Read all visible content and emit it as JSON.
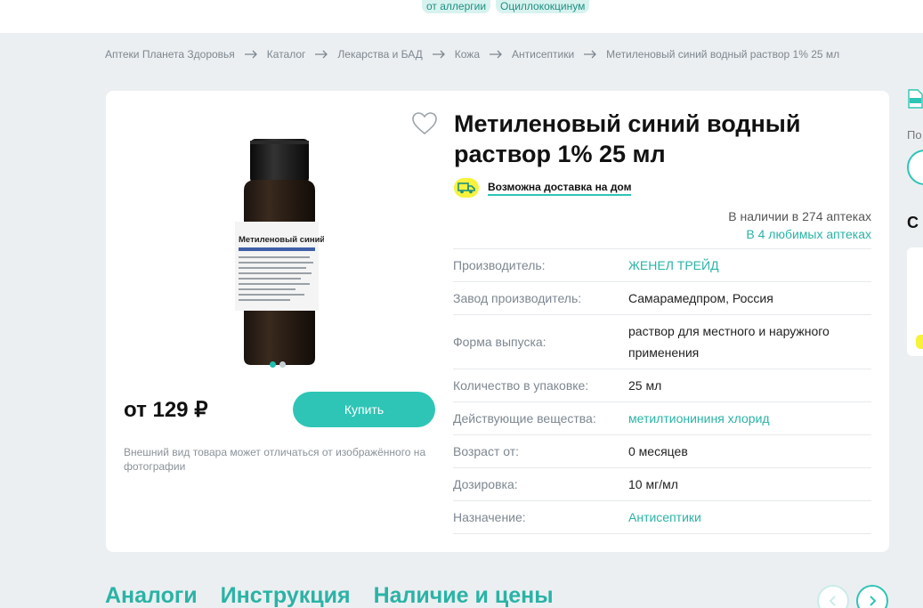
{
  "top_tags": [
    "от аллергии",
    "Оциллококцинум"
  ],
  "breadcrumb": [
    "Аптеки Планета Здоровья",
    "Каталог",
    "Лекарства и БАД",
    "Кожа",
    "Антисептики",
    "Метиленовый синий водный раствор 1% 25 мл"
  ],
  "product": {
    "title": "Метиленовый синий водный раствор 1% 25 мл",
    "delivery_label": "Возможна доставка на дом",
    "availability_count": "В наличии в 274 аптеках",
    "availability_fav": "В 4 любимых аптеках",
    "price": "от 129 ₽",
    "buy_label": "Купить",
    "disclaimer": "Внешний вид товара может отличаться от изображённого на фотографии",
    "bottle_label": "Метиленовый синий",
    "images_total": 2,
    "active_image": 1
  },
  "properties": [
    {
      "label": "Производитель:",
      "value": "ЖЕНЕЛ ТРЕЙД",
      "link": true
    },
    {
      "label": "Завод производитель:",
      "value": "Самарамедпром, Россия",
      "link": false
    },
    {
      "label": "Форма выпуска:",
      "value": "раствор для местного и наружного применения",
      "link": false
    },
    {
      "label": "Количество в упаковке:",
      "value": "25 мл",
      "link": false
    },
    {
      "label": "Действующие вещества:",
      "value": "метилтионининя хлорид",
      "link": true
    },
    {
      "label": "Возраст от:",
      "value": "0 месяцев",
      "link": false
    },
    {
      "label": "Дозировка:",
      "value": "10 мг/мл",
      "link": false
    },
    {
      "label": "Назначение:",
      "value": "Антисептики",
      "link": true
    }
  ],
  "tabs": [
    "Аналоги",
    "Инструкция",
    "Наличие и цены"
  ],
  "side": {
    "text_1": "По",
    "text_2": "С з"
  },
  "colors": {
    "accent": "#2ec5b6",
    "link": "#2ab3a6",
    "delivery_badge": "#f7f23b",
    "background": "#eceff1"
  }
}
